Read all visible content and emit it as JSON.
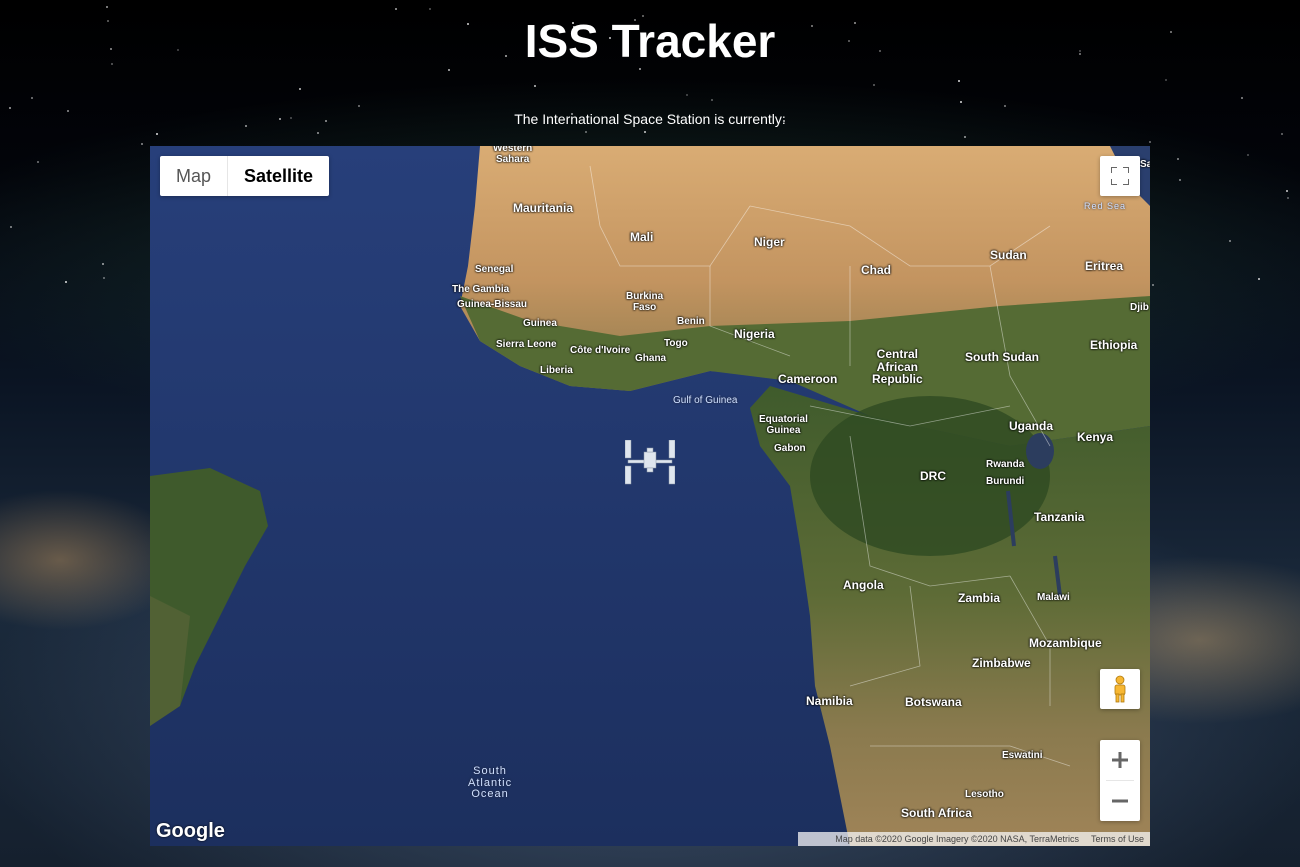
{
  "header": {
    "title": "ISS Tracker",
    "subtitle": "The International Space Station is currently:"
  },
  "map": {
    "type_control": {
      "map_label": "Map",
      "satellite_label": "Satellite",
      "selected": "Satellite"
    },
    "labels": {
      "western_sahara": "Western\nSahara",
      "mauritania": "Mauritania",
      "mali": "Mali",
      "niger": "Niger",
      "sudan": "Sudan",
      "eritrea": "Eritrea",
      "chad": "Chad",
      "senegal": "Senegal",
      "the_gambia": "The Gambia",
      "guinea_bissau": "Guinea-Bissau",
      "burkina_faso": "Burkina\nFaso",
      "benin": "Benin",
      "nigeria": "Nigeria",
      "guinea": "Guinea",
      "sierra_leone": "Sierra Leone",
      "cote_divoire": "Côte d'Ivoire",
      "togo": "Togo",
      "ghana": "Ghana",
      "liberia": "Liberia",
      "central_african_republic": "Central\nAfrican\nRepublic",
      "south_sudan": "South Sudan",
      "ethiopia": "Ethiopia",
      "djibouti": "Djib",
      "red_sea": "Red Sea",
      "sa": "Sa",
      "cameroon": "Cameroon",
      "gulf_of_guinea": "Gulf of Guinea",
      "equatorial_guinea": "Equatorial\nGuinea",
      "gabon": "Gabon",
      "uganda": "Uganda",
      "kenya": "Kenya",
      "rwanda": "Rwanda",
      "burundi": "Burundi",
      "drc": "DRC",
      "tanzania": "Tanzania",
      "angola": "Angola",
      "zambia": "Zambia",
      "malawi": "Malawi",
      "mozambique": "Mozambique",
      "zimbabwe": "Zimbabwe",
      "namibia": "Namibia",
      "botswana": "Botswana",
      "eswatini": "Eswatini",
      "lesotho": "Lesotho",
      "south_africa": "South Africa",
      "south_atlantic_ocean": "South\nAtlantic\nOcean"
    },
    "google_logo": "Google",
    "attribution": "Map data ©2020 Google Imagery ©2020 NASA, TerraMetrics",
    "terms": "Terms of Use",
    "controls": {
      "fullscreen_icon": "fullscreen-icon",
      "pegman_icon": "pegman-icon",
      "zoom_in_icon": "plus-icon",
      "zoom_out_icon": "minus-icon"
    },
    "colors": {
      "ocean": "#22386d",
      "sahara": "#c89a63",
      "vegetation": "#3e5a2c",
      "savanna": "#7a7a4a"
    }
  }
}
